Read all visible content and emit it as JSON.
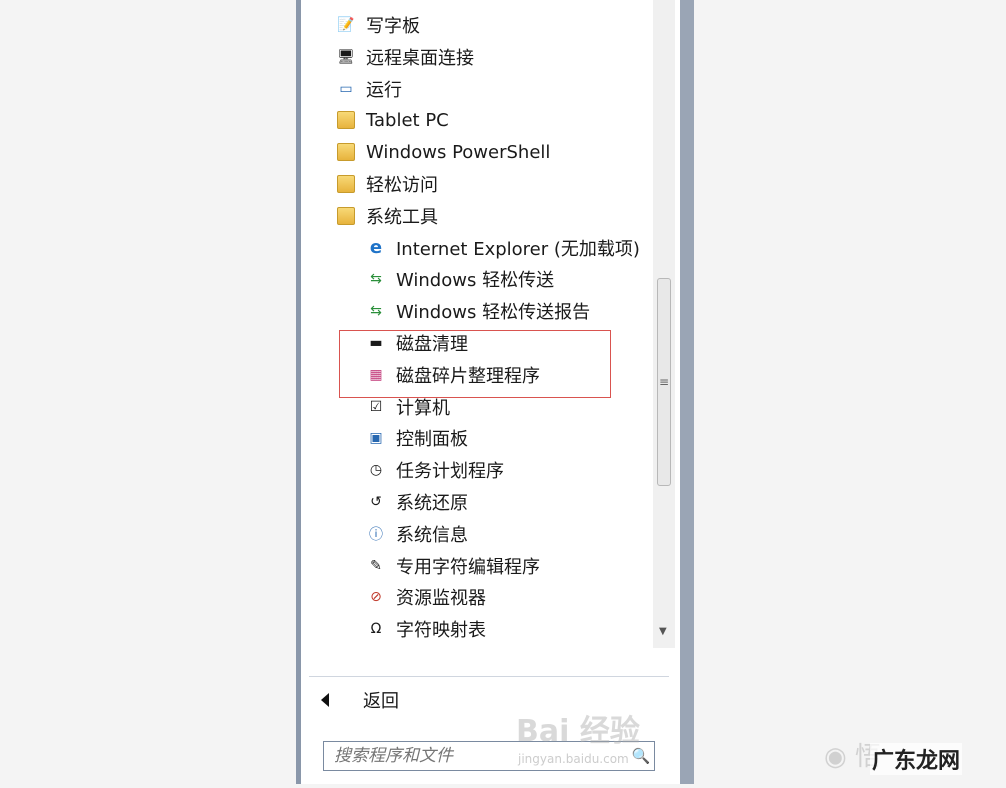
{
  "menu_items": [
    {
      "label": "写字板",
      "icon": "wordpad-icon",
      "glyph": "📝",
      "level": 0
    },
    {
      "label": "远程桌面连接",
      "icon": "remote-desktop-icon",
      "glyph": "🖥",
      "level": 0
    },
    {
      "label": "运行",
      "icon": "run-icon",
      "glyph": "▭",
      "level": 0
    },
    {
      "label": "Tablet PC",
      "icon": "folder-icon",
      "glyph": "",
      "level": 0
    },
    {
      "label": "Windows PowerShell",
      "icon": "folder-icon",
      "glyph": "",
      "level": 0
    },
    {
      "label": "轻松访问",
      "icon": "folder-icon",
      "glyph": "",
      "level": 0
    },
    {
      "label": "系统工具",
      "icon": "folder-icon",
      "glyph": "",
      "level": 0
    },
    {
      "label": "Internet Explorer (无加载项)",
      "icon": "internet-explorer-icon",
      "glyph": "e",
      "level": 1
    },
    {
      "label": "Windows 轻松传送",
      "icon": "easy-transfer-icon",
      "glyph": "⇆",
      "level": 1
    },
    {
      "label": "Windows 轻松传送报告",
      "icon": "easy-transfer-report-icon",
      "glyph": "⇆",
      "level": 1
    },
    {
      "label": "磁盘清理",
      "icon": "disk-cleanup-icon",
      "glyph": "▬",
      "level": 1
    },
    {
      "label": "磁盘碎片整理程序",
      "icon": "defragmenter-icon",
      "glyph": "▦",
      "level": 1
    },
    {
      "label": "计算机",
      "icon": "computer-icon",
      "glyph": "☑",
      "level": 1
    },
    {
      "label": "控制面板",
      "icon": "control-panel-icon",
      "glyph": "▣",
      "level": 1
    },
    {
      "label": "任务计划程序",
      "icon": "task-scheduler-icon",
      "glyph": "◷",
      "level": 1
    },
    {
      "label": "系统还原",
      "icon": "system-restore-icon",
      "glyph": "↺",
      "level": 1
    },
    {
      "label": "系统信息",
      "icon": "system-info-icon",
      "glyph": "ⓘ",
      "level": 1
    },
    {
      "label": "专用字符编辑程序",
      "icon": "private-character-editor-icon",
      "glyph": "✎",
      "level": 1
    },
    {
      "label": "资源监视器",
      "icon": "resource-monitor-icon",
      "glyph": "⊘",
      "level": 1
    },
    {
      "label": "字符映射表",
      "icon": "character-map-icon",
      "glyph": "Ω",
      "level": 1
    }
  ],
  "back": {
    "label": "返回"
  },
  "search": {
    "placeholder": "搜索程序和文件"
  },
  "watermarks": {
    "baidu": "Bai 经验",
    "baidu_url": "jingyan.baidu.com",
    "site": "广东龙网"
  },
  "colors": {
    "highlight_border": "#d9534f",
    "folder": "#e7b33d"
  }
}
